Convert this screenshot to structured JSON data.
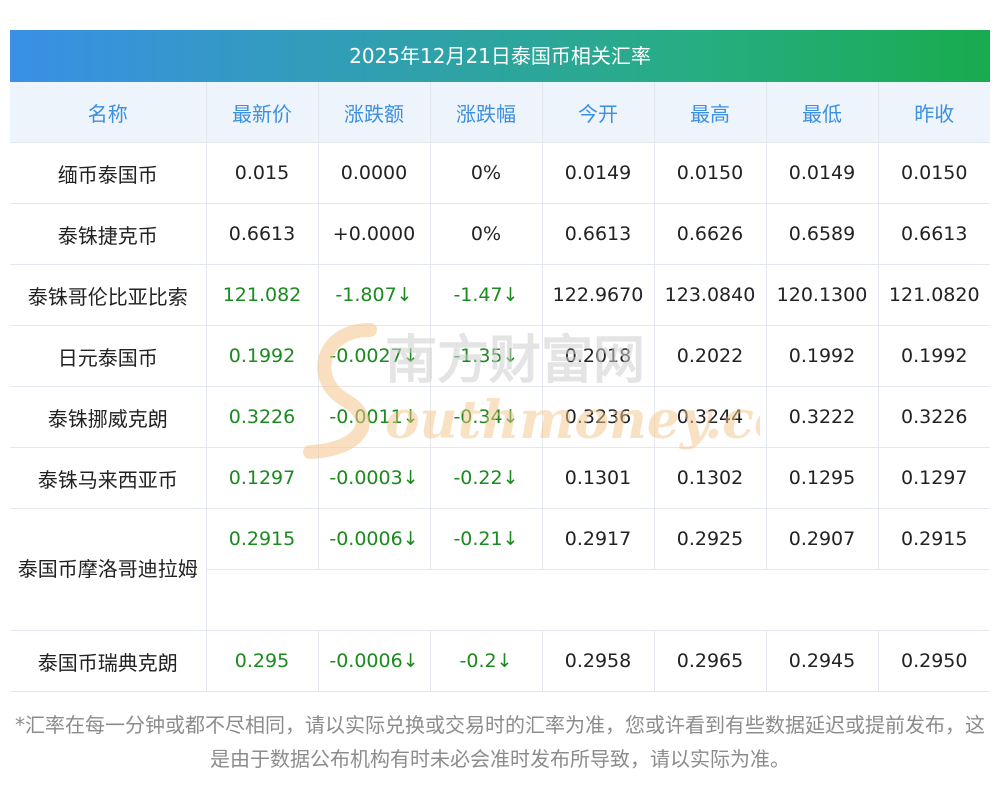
{
  "title": "2025年12月21日泰国币相关汇率",
  "headers": [
    "名称",
    "最新价",
    "涨跌额",
    "涨跌幅",
    "今开",
    "最高",
    "最低",
    "昨收"
  ],
  "rows": [
    {
      "name": "缅币泰国币",
      "latest": "0.015",
      "change": "0.0000",
      "pct": "0%",
      "open": "0.0149",
      "high": "0.0150",
      "low": "0.0149",
      "prev": "0.0150"
    },
    {
      "name": "泰铢捷克币",
      "latest": "0.6613",
      "change": "+0.0000",
      "pct": "0%",
      "open": "0.6613",
      "high": "0.6626",
      "low": "0.6589",
      "prev": "0.6613"
    },
    {
      "name": "泰铢哥伦比亚比索",
      "latest": "121.082",
      "change": "-1.807↓",
      "pct": "-1.47↓",
      "open": "122.9670",
      "high": "123.0840",
      "low": "120.1300",
      "prev": "121.0820"
    },
    {
      "name": "日元泰国币",
      "latest": "0.1992",
      "change": "-0.0027↓",
      "pct": "-1.35↓",
      "open": "0.2018",
      "high": "0.2022",
      "low": "0.1992",
      "prev": "0.1992"
    },
    {
      "name": "泰铢挪威克朗",
      "latest": "0.3226",
      "change": "-0.0011↓",
      "pct": "-0.34↓",
      "open": "0.3236",
      "high": "0.3244",
      "low": "0.3222",
      "prev": "0.3226"
    },
    {
      "name": "泰铢马来西亚币",
      "latest": "0.1297",
      "change": "-0.0003↓",
      "pct": "-0.22↓",
      "open": "0.1301",
      "high": "0.1302",
      "low": "0.1295",
      "prev": "0.1297"
    },
    {
      "name": "泰国币摩洛哥迪拉姆",
      "latest": "0.2915",
      "change": "-0.0006↓",
      "pct": "-0.21↓",
      "open": "0.2917",
      "high": "0.2925",
      "low": "0.2907",
      "prev": "0.2915"
    },
    {
      "name": "泰国币瑞典克朗",
      "latest": "0.295",
      "change": "-0.0006↓",
      "pct": "-0.2↓",
      "open": "0.2958",
      "high": "0.2965",
      "low": "0.2945",
      "prev": "0.2950"
    }
  ],
  "watermark": {
    "cn": "南方财富网",
    "en": "Southmoney.com"
  },
  "note": "*汇率在每一分钟或都不尽相同，请以实际兑换或交易时的汇率为准，您或许看到有些数据延迟或提前发布，这是由于数据公布机构有时未必会准时发布所导致，请以实际为准。",
  "colors": {
    "header_text": "#3d8fe0",
    "header_bg": "#eef4fb",
    "down": "#1b8a1f",
    "title_start": "#3a8fe6",
    "title_end": "#19ab4e"
  }
}
